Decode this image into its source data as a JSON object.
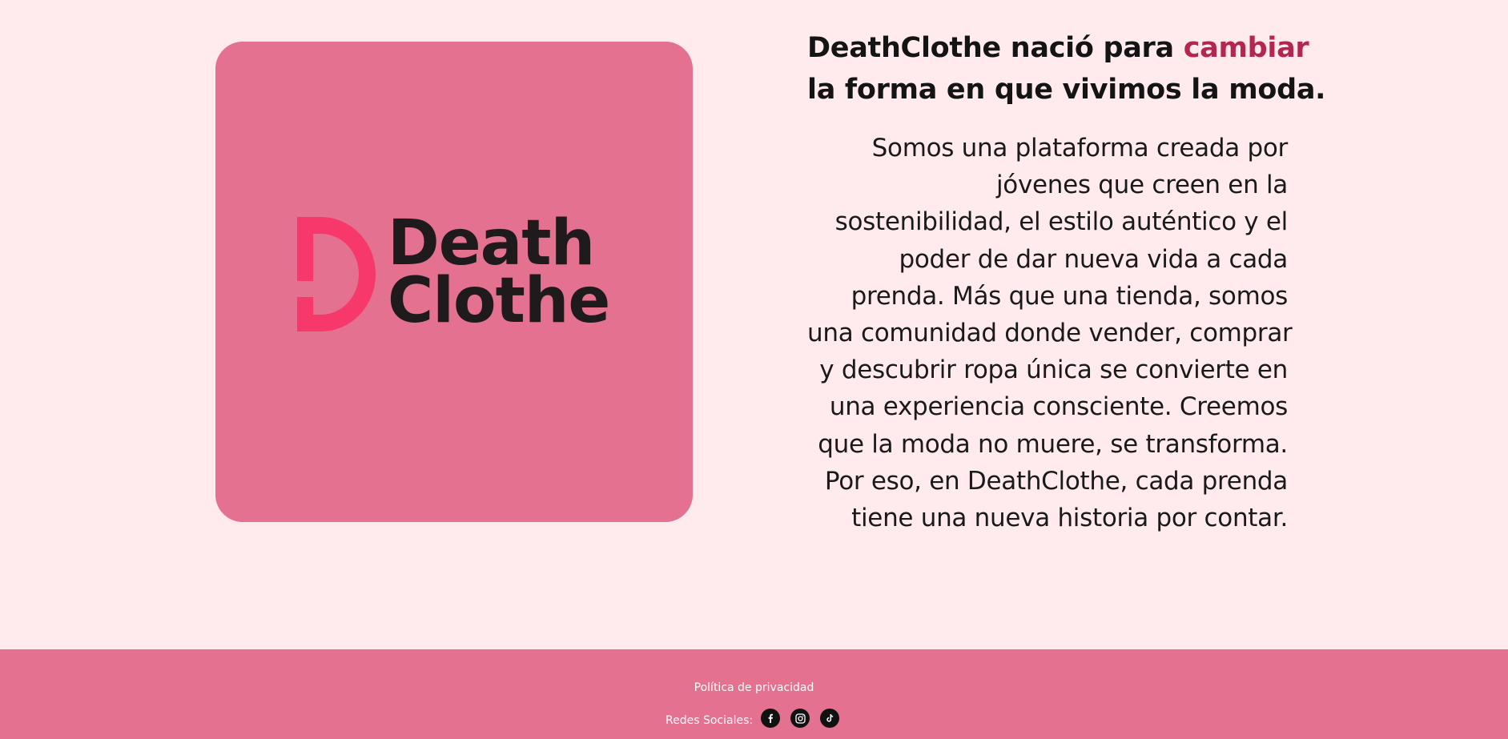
{
  "logo": {
    "line1": "Death",
    "line2": "Clothe",
    "mark_color": "#f7386a",
    "text_color": "#1f1b1c",
    "card_color": "#e3718f"
  },
  "headline": {
    "part1": "DeathClothe nació para ",
    "accent": "cambiar",
    "line2": "la forma en que vivimos la moda.",
    "accent_color": "#b3264f"
  },
  "body_lines": [
    "Somos una plataforma creada por",
    "jóvenes que creen en la",
    "sostenibilidad, el estilo auténtico y el",
    "poder de dar nueva vida a cada",
    "prenda. Más que una tienda, somos",
    "una comunidad donde vender, comprar",
    "y descubrir ropa única se convierte en",
    "una experiencia consciente. Creemos",
    "que la moda no muere, se transforma.",
    "Por eso, en DeathClothe, cada prenda",
    "tiene una nueva historia por contar."
  ],
  "footer": {
    "privacy_label": "Política de privacidad",
    "social_label": "Redes Sociales:",
    "social_icons": [
      "facebook-icon",
      "instagram-icon",
      "tiktok-icon"
    ],
    "background": "#e3718f"
  },
  "page_background": "#ffebee"
}
